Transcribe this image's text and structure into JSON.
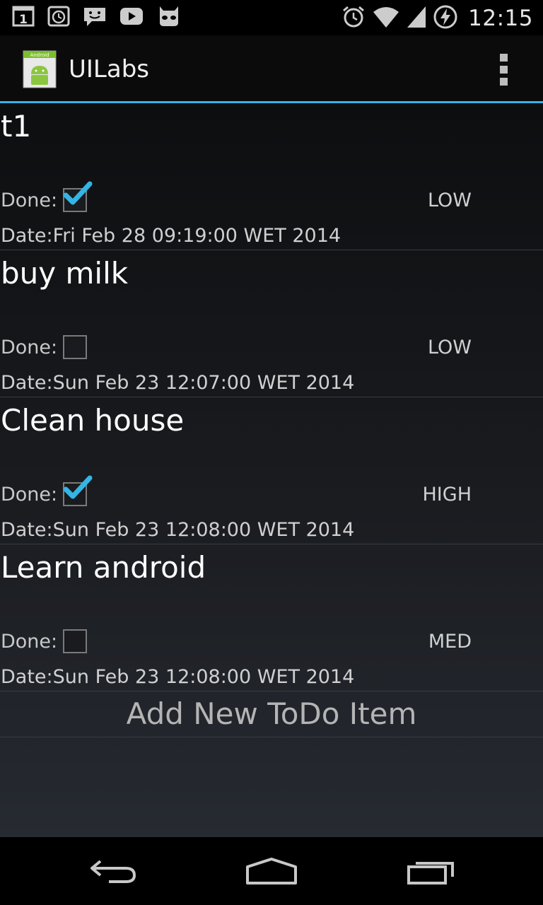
{
  "status_bar": {
    "time": "12:15",
    "left_icons": [
      "calendar-icon",
      "alarm-icon",
      "chat-icon",
      "youtube-icon",
      "cyanogen-icon"
    ],
    "calendar_day": "1",
    "right_icons": [
      "alarm-icon",
      "wifi-icon",
      "signal-icon",
      "battery-charging-icon"
    ]
  },
  "action_bar": {
    "title": "UILabs",
    "logo_text": "Android",
    "overflow_icon": "overflow-menu-icon"
  },
  "items": [
    {
      "title": "t1",
      "done_label": "Done:",
      "done": true,
      "priority": "LOW",
      "date": "Date:Fri Feb 28 09:19:00 WET 2014"
    },
    {
      "title": "buy milk",
      "done_label": "Done:",
      "done": false,
      "priority": "LOW",
      "date": "Date:Sun Feb 23 12:07:00 WET 2014"
    },
    {
      "title": "Clean house",
      "done_label": "Done:",
      "done": true,
      "priority": "HIGH",
      "date": "Date:Sun Feb 23 12:08:00 WET 2014"
    },
    {
      "title": "Learn android",
      "done_label": "Done:",
      "done": false,
      "priority": "MED",
      "date": "Date:Sun Feb 23 12:08:00 WET 2014"
    }
  ],
  "footer": {
    "add_label": "Add New ToDo Item"
  },
  "nav_bar": {
    "icons": [
      "back-icon",
      "home-icon",
      "recents-icon"
    ]
  },
  "colors": {
    "accent": "#33b5e5",
    "check": "#33b5e5"
  }
}
